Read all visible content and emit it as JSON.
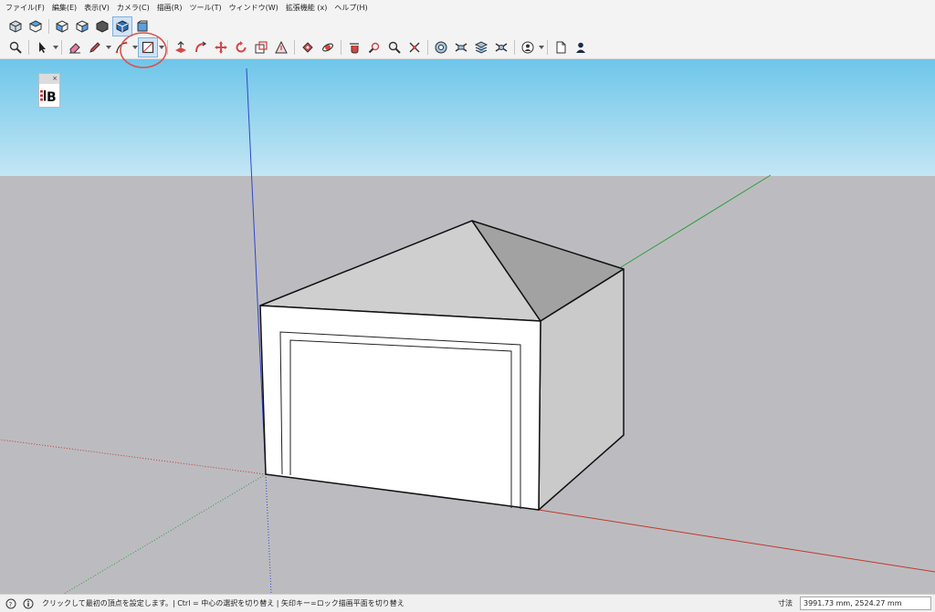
{
  "menu": [
    "ファイル(F)",
    "編集(E)",
    "表示(V)",
    "カメラ(C)",
    "描画(R)",
    "ツール(T)",
    "ウィンドウ(W)",
    "拡張機能 (x)",
    "ヘルプ(H)"
  ],
  "colors": {
    "sky_top": "#6ec6ea",
    "sky_bottom": "#c3e6f4",
    "ground": "#bcbcc0",
    "axis_red": "#c0392b",
    "axis_green": "#2e9e3a",
    "axis_blue": "#3344c8",
    "highlight_ring": "#d9534f",
    "roof_light": "#cfcfcf",
    "roof_dark": "#a2a2a2",
    "wall_side": "#cacaca",
    "wall_front": "#ffffff"
  },
  "toolbar_top_icons": [
    "iso-view-icon",
    "top-view-icon",
    "front-view-icon",
    "right-view-icon",
    "back-view-icon",
    "left-view-icon",
    "bottom-view-icon"
  ],
  "toolbar_main_icons": [
    "zoom-icon",
    "select-icon",
    "eraser-icon",
    "pencil-icon",
    "line-icon",
    "rectangle-icon",
    "push-pull-icon",
    "follow-me-icon",
    "move-icon",
    "rotate-icon",
    "scale-icon",
    "protractor-icon",
    "paint-bucket-icon",
    "orbit-icon",
    "pan-icon",
    "zoom-extents-icon",
    "zoom-window-icon",
    "section-plane-icon",
    "dimensions-icon",
    "text-icon",
    "3d-text-icon",
    "axes-icon",
    "user-icon",
    "model-info-icon",
    "account-icon"
  ],
  "mini_panel": {
    "logo": "B",
    "close": "×"
  },
  "status": {
    "text": "クリックして最初の頂点を設定します。| Ctrl = 中心の選択を切り替え | 矢印キー=ロック描画平面を切り替え",
    "measure_label": "寸法",
    "measure_value": "3991.73 mm, 2524.27 mm"
  }
}
